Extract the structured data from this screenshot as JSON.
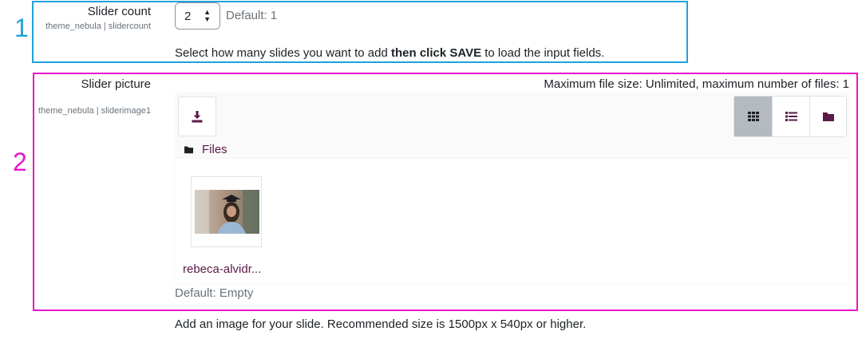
{
  "annotations": {
    "box1_number": "1",
    "box2_number": "2"
  },
  "slider_count": {
    "label": "Slider count",
    "setting_id": "theme_nebula | slidercount",
    "selected_value": "2",
    "default_text": "Default: 1",
    "description_before": "Select how many slides you want to add ",
    "description_bold": "then click SAVE",
    "description_after": " to load the input fields."
  },
  "slider_picture": {
    "label": "Slider picture",
    "setting_id": "theme_nebula | sliderimage1",
    "limits_text": "Maximum file size: Unlimited, maximum number of files: 1",
    "path_folder": "Files",
    "files": [
      {
        "name": "rebeca-alvidr..."
      }
    ],
    "default_text": "Default: Empty",
    "description": "Add an image for your slide. Recommended size is 1500px x 540px or higher."
  },
  "icons": {
    "add_file": "download-icon",
    "view_icons": "grid-icon",
    "view_list": "list-icon",
    "view_tree": "folder-icon",
    "path": "folder-icon"
  },
  "colors": {
    "annotation_1": "#1ea1dc",
    "annotation_2": "#e815c8",
    "brand": "#5b1a47",
    "active_view": "#b4bac0"
  }
}
